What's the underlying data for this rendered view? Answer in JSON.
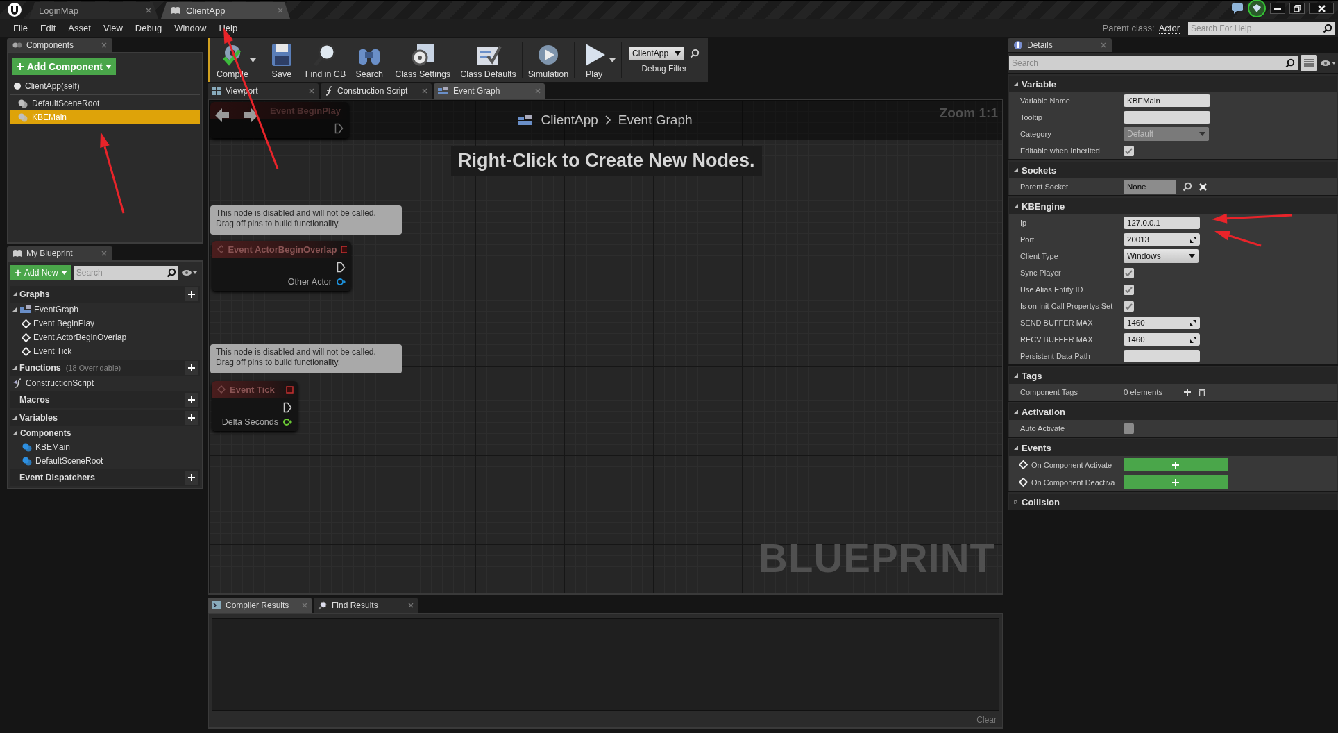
{
  "document_tabs": [
    {
      "label": "LoginMap",
      "selected": false
    },
    {
      "label": "ClientApp",
      "selected": true
    }
  ],
  "menu": [
    "File",
    "Edit",
    "Asset",
    "View",
    "Debug",
    "Window",
    "Help"
  ],
  "parent_class": {
    "label": "Parent class:",
    "value": "Actor"
  },
  "help_search": {
    "placeholder": "Search For Help"
  },
  "components_panel": {
    "title": "Components",
    "add_button": "Add Component",
    "items": [
      {
        "label": "ClientApp(self)",
        "selected": false,
        "children": [
          {
            "label": "DefaultSceneRoot",
            "selected": false
          },
          {
            "label": "KBEMain",
            "selected": true
          }
        ]
      }
    ]
  },
  "my_blueprint": {
    "title": "My Blueprint",
    "add_button": "Add New",
    "search": {
      "placeholder": "Search"
    },
    "sections": [
      {
        "title": "Graphs",
        "items": [
          {
            "label": "EventGraph",
            "kind": "graph",
            "children": [
              {
                "label": "Event BeginPlay",
                "kind": "event"
              },
              {
                "label": "Event ActorBeginOverlap",
                "kind": "event"
              },
              {
                "label": "Event Tick",
                "kind": "event"
              }
            ]
          }
        ]
      },
      {
        "title": "Functions",
        "note": "(18 Overridable)",
        "items": [
          {
            "label": "ConstructionScript",
            "kind": "function"
          }
        ]
      },
      {
        "title": "Macros"
      },
      {
        "title": "Variables",
        "items": [
          {
            "label": "Components",
            "kind": "category",
            "children": [
              {
                "label": "KBEMain",
                "kind": "component"
              },
              {
                "label": "DefaultSceneRoot",
                "kind": "component"
              }
            ]
          }
        ]
      },
      {
        "title": "Event Dispatchers"
      }
    ]
  },
  "toolbar": [
    {
      "label": "Compile",
      "kind": "compile",
      "menu": true
    },
    {
      "label": "Save",
      "kind": "save",
      "menu": false
    },
    {
      "label": "Find in CB",
      "kind": "find",
      "menu": false
    },
    {
      "label": "Search",
      "kind": "search",
      "menu": false
    },
    {
      "label": "Class Settings",
      "kind": "settings",
      "menu": false
    },
    {
      "label": "Class Defaults",
      "kind": "defaults",
      "menu": false
    },
    {
      "label": "Simulation",
      "kind": "simulation",
      "menu": false
    },
    {
      "label": "Play",
      "kind": "play",
      "menu": true
    }
  ],
  "debug_filter": {
    "value": "ClientApp",
    "label": "Debug Filter"
  },
  "graph_tabs": [
    {
      "label": "Viewport",
      "kind": "viewport",
      "selected": false
    },
    {
      "label": "Construction Script",
      "kind": "function",
      "selected": false
    },
    {
      "label": "Event Graph",
      "kind": "graph",
      "selected": true
    }
  ],
  "graph": {
    "breadcrumb": [
      "ClientApp",
      "Event Graph"
    ],
    "zoom": "Zoom 1:1",
    "hint": "Right-Click to Create New Nodes.",
    "watermark": "BLUEPRINT",
    "nodes": [
      {
        "title": "Event BeginPlay"
      },
      {
        "title": "Event ActorBeginOverlap",
        "comment": "This node is disabled and will not be called.\nDrag off pins to build functionality.",
        "pin": {
          "label": "Other Actor",
          "color": "#1d8fd8"
        }
      },
      {
        "title": "Event Tick",
        "comment": "This node is disabled and will not be called.\nDrag off pins to build functionality.",
        "pin": {
          "label": "Delta Seconds",
          "color": "#6ccb35"
        }
      }
    ]
  },
  "output_tabs": [
    {
      "label": "Compiler Results",
      "selected": true
    },
    {
      "label": "Find Results",
      "selected": false
    }
  ],
  "clear_button": "Clear",
  "details": {
    "title": "Details",
    "search": {
      "placeholder": "Search"
    },
    "sections": [
      {
        "title": "Variable",
        "expanded": true,
        "rows": [
          {
            "label": "Variable Name",
            "kind": "text",
            "value": "KBEMain"
          },
          {
            "label": "Tooltip",
            "kind": "text"
          },
          {
            "label": "Category",
            "kind": "combo",
            "value": "Default"
          },
          {
            "label": "Editable when Inherited",
            "kind": "check",
            "checked": true
          }
        ]
      },
      {
        "title": "Sockets",
        "expanded": true,
        "rows": [
          {
            "label": "Parent Socket",
            "kind": "socket",
            "value": "None"
          }
        ]
      },
      {
        "title": "KBEngine",
        "expanded": true,
        "rows": [
          {
            "label": "Ip",
            "kind": "text",
            "value": "127.0.0.1"
          },
          {
            "label": "Port",
            "kind": "number",
            "value": "20013"
          },
          {
            "label": "Client Type",
            "kind": "combo",
            "value": "Windows"
          },
          {
            "label": "Sync Player",
            "kind": "check",
            "checked": true
          },
          {
            "label": "Use Alias Entity ID",
            "kind": "check",
            "checked": true
          },
          {
            "label": "Is on Init Call Propertys Set",
            "kind": "check",
            "checked": true
          },
          {
            "label": "SEND BUFFER MAX",
            "kind": "number",
            "value": "1460"
          },
          {
            "label": "RECV BUFFER MAX",
            "kind": "number",
            "value": "1460"
          },
          {
            "label": "Persistent Data Path",
            "kind": "text"
          }
        ]
      },
      {
        "title": "Tags",
        "expanded": true,
        "rows": [
          {
            "label": "Component Tags",
            "kind": "array",
            "value": "0 elements"
          }
        ]
      },
      {
        "title": "Activation",
        "expanded": true,
        "rows": [
          {
            "label": "Auto Activate",
            "kind": "check",
            "checked": false
          }
        ]
      },
      {
        "title": "Events",
        "expanded": true,
        "rows": [
          {
            "label": "On Component Activate",
            "kind": "event"
          },
          {
            "label": "On Component Deactiva",
            "kind": "event"
          }
        ]
      },
      {
        "title": "Collision",
        "expanded": false
      }
    ]
  }
}
